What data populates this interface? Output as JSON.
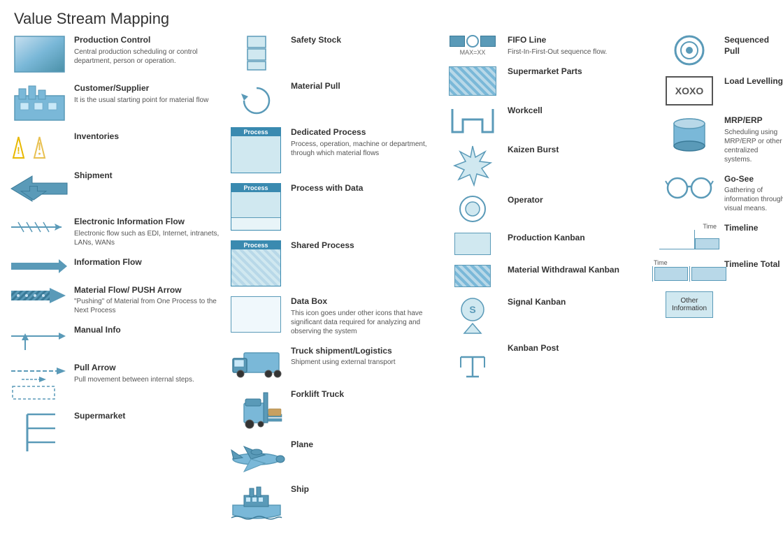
{
  "title": "Value Stream Mapping",
  "columns": {
    "col1": {
      "items": [
        {
          "id": "production-control",
          "label": "Production Control",
          "desc": "Central production scheduling or control department, person or operation.",
          "icon": "production-control-icon"
        },
        {
          "id": "customer-supplier",
          "label": "Customer/Supplier",
          "desc": "It is the usual starting point for material flow",
          "icon": "customer-supplier-icon"
        },
        {
          "id": "inventories",
          "label": "Inventories",
          "desc": "",
          "icon": "inventories-icon"
        },
        {
          "id": "shipment",
          "label": "Shipment",
          "desc": "",
          "icon": "shipment-icon"
        },
        {
          "id": "electronic-info-flow",
          "label": "Electronic Information Flow",
          "desc": "Electronic flow such as EDI, Internet, intranets, LANs, WANs",
          "icon": "electronic-info-flow-icon"
        },
        {
          "id": "information-flow",
          "label": "Information Flow",
          "desc": "",
          "icon": "information-flow-icon"
        },
        {
          "id": "material-flow-push",
          "label": "Material Flow/ PUSH Arrow",
          "desc": "\"Pushing\" of Material from One Process to the Next Process",
          "icon": "material-flow-push-icon"
        },
        {
          "id": "manual-info",
          "label": "Manual Info",
          "desc": "",
          "icon": "manual-info-icon"
        },
        {
          "id": "pull-arrow",
          "label": "Pull Arrow",
          "desc": "Pull movement between internal steps.",
          "icon": "pull-arrow-icon"
        },
        {
          "id": "supermarket",
          "label": "Supermarket",
          "desc": "",
          "icon": "supermarket-icon"
        }
      ]
    },
    "col2": {
      "items": [
        {
          "id": "safety-stock",
          "label": "Safety Stock",
          "desc": "",
          "icon": "safety-stock-icon"
        },
        {
          "id": "material-pull",
          "label": "Material Pull",
          "desc": "",
          "icon": "material-pull-icon"
        },
        {
          "id": "dedicated-process",
          "label": "Dedicated Process",
          "desc": "Process, operation, machine or department, through which material flows",
          "icon": "dedicated-process-icon"
        },
        {
          "id": "process-with-data",
          "label": "Process with Data",
          "desc": "",
          "icon": "process-with-data-icon"
        },
        {
          "id": "shared-process",
          "label": "Shared Process",
          "desc": "",
          "icon": "shared-process-icon"
        },
        {
          "id": "data-box",
          "label": "Data Box",
          "desc": "This icon goes under other icons that have significant data required for analyzing and observing the system",
          "icon": "data-box-icon"
        },
        {
          "id": "truck-shipment",
          "label": "Truck shipment/Logistics",
          "desc": "Shipment using external transport",
          "icon": "truck-shipment-icon"
        },
        {
          "id": "forklift-truck",
          "label": "Forklift Truck",
          "desc": "",
          "icon": "forklift-truck-icon"
        },
        {
          "id": "plane",
          "label": "Plane",
          "desc": "",
          "icon": "plane-icon"
        },
        {
          "id": "ship",
          "label": "Ship",
          "desc": "",
          "icon": "ship-icon"
        }
      ]
    },
    "col3": {
      "items": [
        {
          "id": "fifo-line",
          "label": "FIFO Line",
          "desc": "First-In-First-Out sequence flow.",
          "subtext": "MAX=XX",
          "icon": "fifo-line-icon"
        },
        {
          "id": "supermarket-parts",
          "label": "Supermarket Parts",
          "desc": "",
          "icon": "supermarket-parts-icon"
        },
        {
          "id": "workcell",
          "label": "Workcell",
          "desc": "",
          "icon": "workcell-icon"
        },
        {
          "id": "kaizen-burst",
          "label": "Kaizen Burst",
          "desc": "",
          "icon": "kaizen-burst-icon"
        },
        {
          "id": "operator",
          "label": "Operator",
          "desc": "",
          "icon": "operator-icon"
        },
        {
          "id": "production-kanban",
          "label": "Production Kanban",
          "desc": "",
          "icon": "production-kanban-icon"
        },
        {
          "id": "material-withdrawal-kanban",
          "label": "Material Withdrawal Kanban",
          "desc": "",
          "icon": "material-withdrawal-kanban-icon"
        },
        {
          "id": "signal-kanban",
          "label": "Signal Kanban",
          "desc": "",
          "icon": "signal-kanban-icon"
        },
        {
          "id": "kanban-post",
          "label": "Kanban Post",
          "desc": "",
          "icon": "kanban-post-icon"
        }
      ]
    },
    "col4": {
      "items": [
        {
          "id": "sequenced-pull",
          "label": "Sequenced Pull",
          "desc": "",
          "icon": "sequenced-pull-icon"
        },
        {
          "id": "load-levelling",
          "label": "Load Levelling",
          "desc": "",
          "icon": "load-levelling-icon"
        },
        {
          "id": "mrp-erp",
          "label": "MRP/ERP",
          "desc": "Scheduling using MRP/ERP or other centralized systems.",
          "icon": "mrp-erp-icon"
        },
        {
          "id": "go-see",
          "label": "Go-See",
          "desc": "Gathering of information through visual means.",
          "icon": "go-see-icon"
        },
        {
          "id": "timeline",
          "label": "Timeline",
          "desc": "",
          "icon": "timeline-icon",
          "subtext": "Time"
        },
        {
          "id": "timeline-total",
          "label": "Timeline Total",
          "desc": "",
          "icon": "timeline-total-icon",
          "subtext": "Time"
        },
        {
          "id": "other-information",
          "label": "Other Information",
          "desc": "",
          "icon": "other-information-icon"
        }
      ]
    }
  }
}
